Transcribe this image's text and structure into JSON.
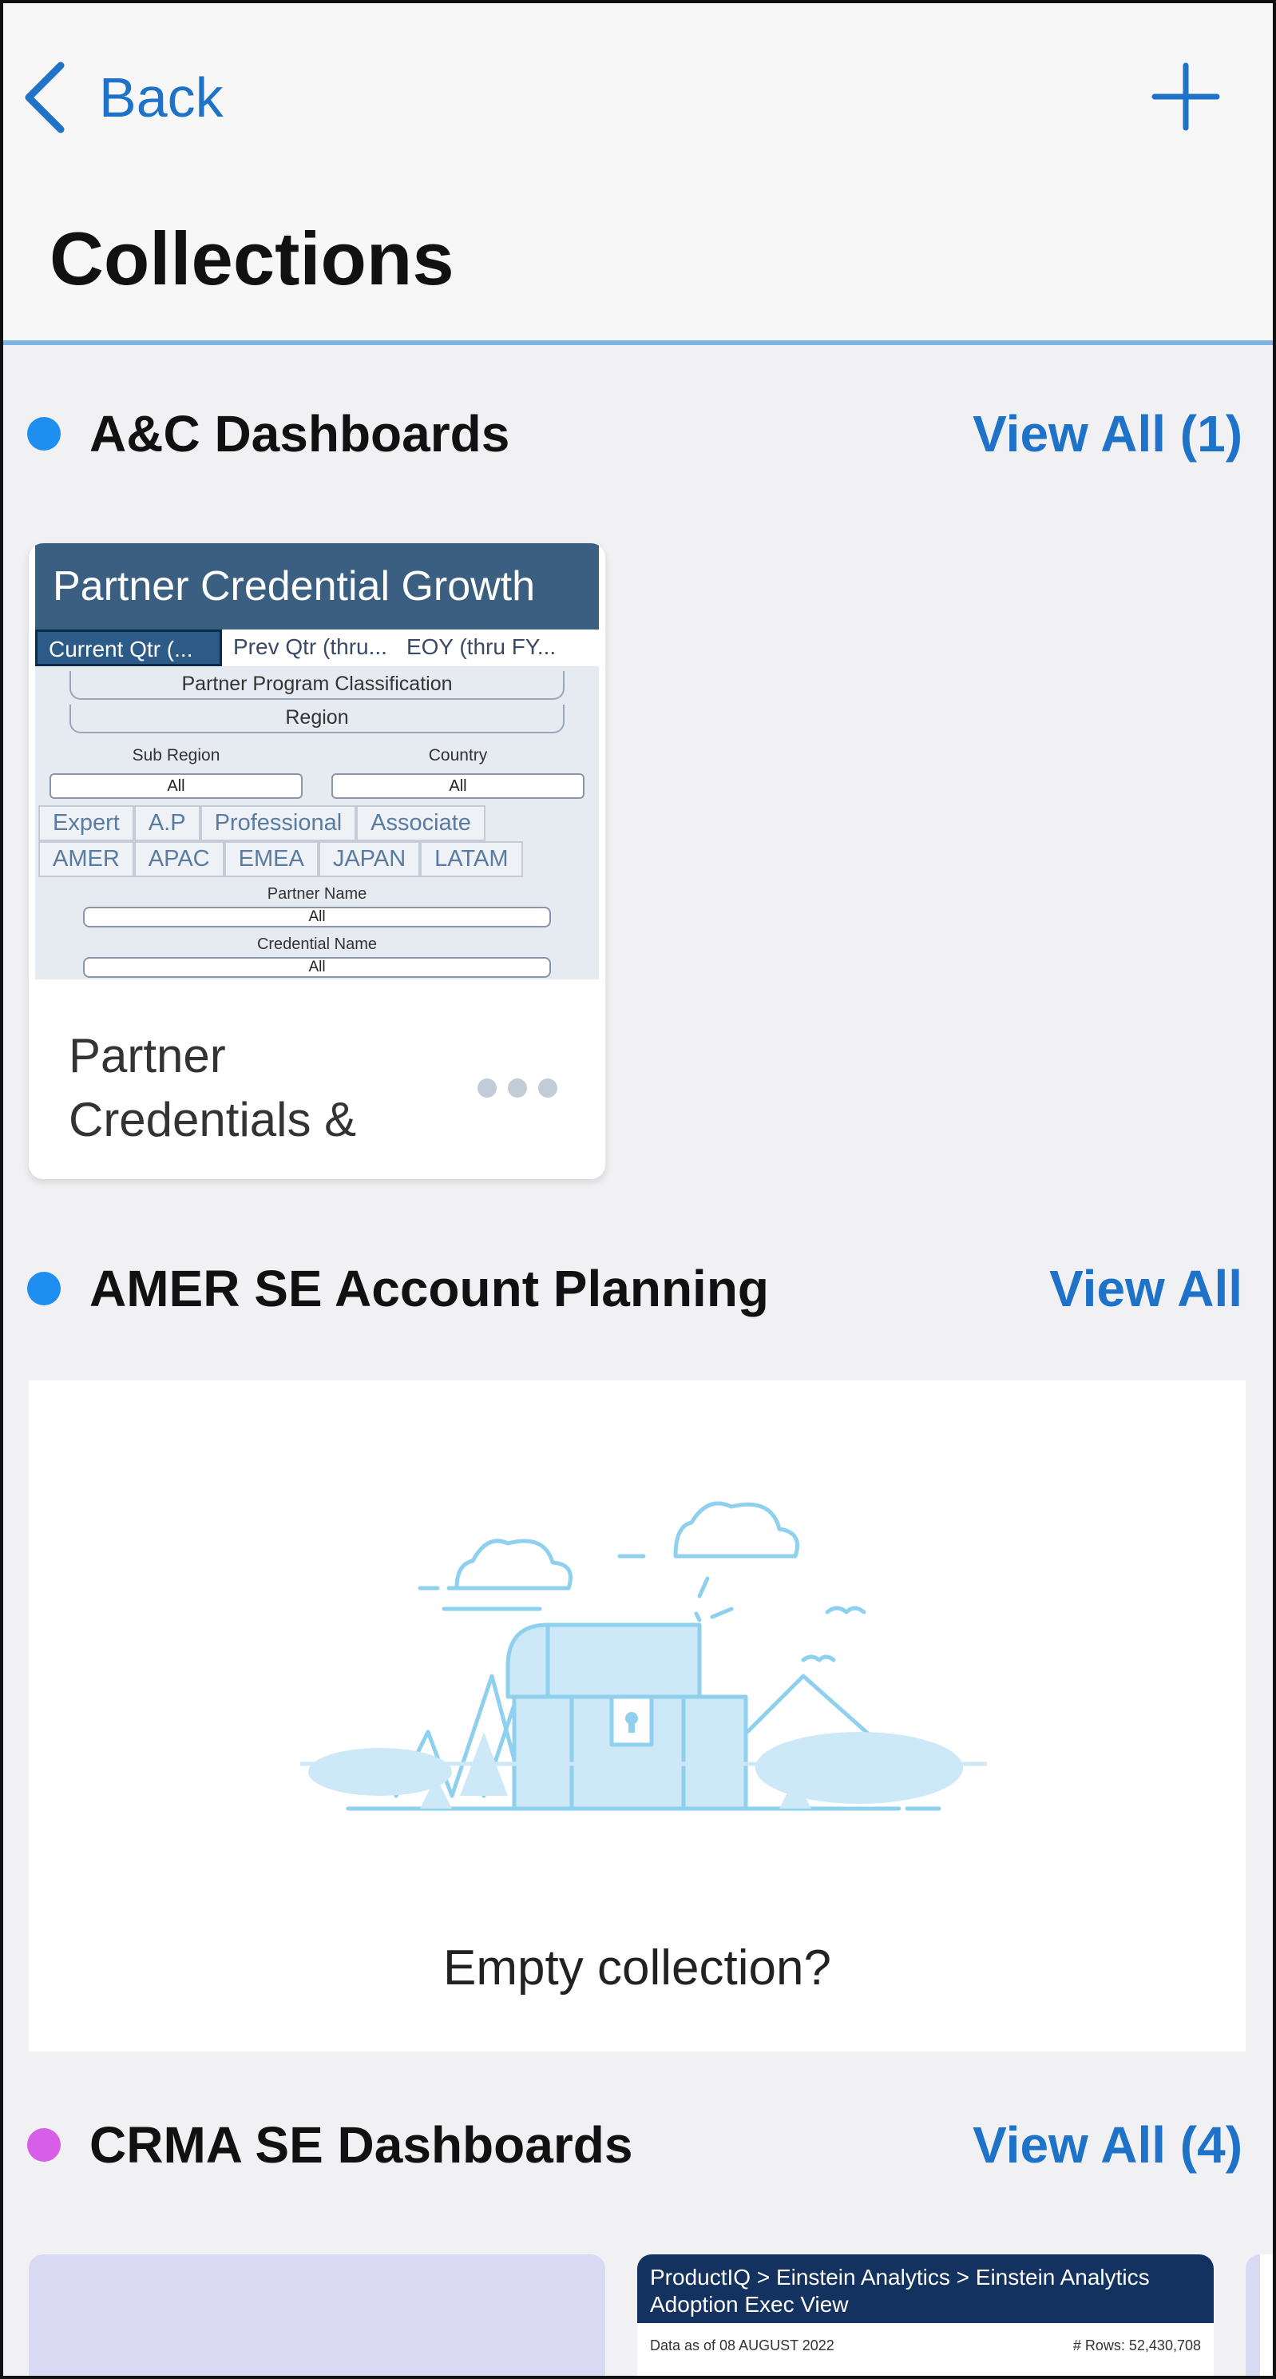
{
  "nav": {
    "back_label": "Back",
    "back_icon": "chevron-left-icon",
    "add_icon": "plus-icon"
  },
  "page_title": "Collections",
  "colors": {
    "accent": "#1e72c8",
    "dot_blue": "#1e8ef0",
    "dot_purple": "#d65ee8"
  },
  "sections": [
    {
      "title": "A&C Dashboards",
      "view_all": "View All (1)",
      "card": {
        "name": "Partner Credentials &",
        "thumbnail": {
          "title": "Partner Credential Growth",
          "tabs": [
            "Current Qtr (...",
            "Prev Qtr (thru...",
            "EOY (thru FY..."
          ],
          "program_label": "Partner Program Classification",
          "region_label": "Region",
          "sub_region_label": "Sub Region",
          "country_label": "Country",
          "sub_region_value": "All",
          "country_value": "All",
          "levels": [
            "Expert",
            "A.P",
            "Professional",
            "Associate"
          ],
          "regions": [
            "AMER",
            "APAC",
            "EMEA",
            "JAPAN",
            "LATAM"
          ],
          "partner_name_label": "Partner Name",
          "partner_name_value": "All",
          "credential_name_label": "Credential Name",
          "credential_name_value": "All"
        }
      }
    },
    {
      "title": "AMER SE Account Planning",
      "view_all": "View All",
      "empty_text": "Empty collection?"
    },
    {
      "title": "CRMA SE Dashboards",
      "view_all": "View All (4)",
      "card2": {
        "header": "ProductIQ > Einstein Analytics > Einstein Analytics Adoption Exec View",
        "date_text": "Data as of 08 AUGUST 2022",
        "rows_text": "# Rows: 52,430,708"
      }
    }
  ]
}
